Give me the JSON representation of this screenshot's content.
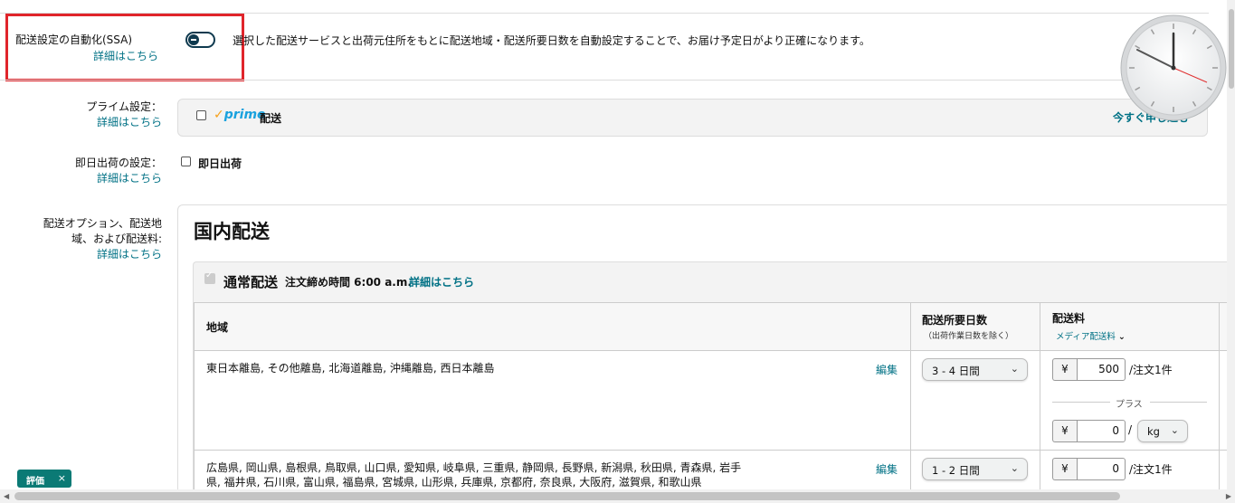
{
  "ssa": {
    "label": "配送設定の自動化(SSA)",
    "link": "詳細はこちら",
    "description": "選択した配送サービスと出荷元住所をもとに配送地域・配送所要日数を自動設定することで、お届け予定日がより正確になります。"
  },
  "prime": {
    "label": "プライム設定：",
    "link": "詳細はこちら",
    "logo_text": "prime",
    "option_label": "配送",
    "apply_link": "今すぐ申し込む"
  },
  "same_day": {
    "label": "即日出荷の設定：",
    "link": "詳細はこちら",
    "option_label": "即日出荷"
  },
  "shipping_options": {
    "label_line1": "配送オプション、配送地",
    "label_line2": "域、および配送料:",
    "link": "詳細はこちら"
  },
  "domestic": {
    "title": "国内配送",
    "standard": {
      "title": "通常配送",
      "cutoff": "注文締め時間 6:00 a.m.",
      "link": "詳細はこちら"
    },
    "table": {
      "col_region": "地域",
      "col_days": "配送所要日数",
      "col_days_sub": "（出荷作業日数を除く）",
      "col_fee": "配送料",
      "col_fee_sub": "メディア配送料",
      "rows": [
        {
          "region": "東日本離島, その他離島, 北海道離島, 沖縄離島, 西日本離島",
          "edit": "編集",
          "days": "3 - 4 日間",
          "currency": "¥",
          "fee": "500",
          "per": "/注文1件",
          "plus": "プラス",
          "weight_fee": "0",
          "weight_unit": "kg"
        },
        {
          "region_line1": "広島県, 岡山県, 島根県, 鳥取県, 山口県, 愛知県, 岐阜県, 三重県, 静岡県, 長野県, 新潟県, 秋田県, 青森県, 岩手",
          "region_line2": "県, 福井県, 石川県, 富山県, 福島県, 宮城県, 山形県, 兵庫県, 京都府, 奈良県, 大阪府, 滋賀県, 和歌山県",
          "edit": "編集",
          "days": "1 - 2 日間",
          "currency": "¥",
          "fee": "0",
          "per": "/注文1件"
        }
      ]
    }
  },
  "badge": {
    "label": "評価",
    "close": "×"
  },
  "colors": {
    "link": "#007185",
    "highlight_border": "#e0252b",
    "toggle": "#0f3a4f",
    "badge_bg": "#0b7a75",
    "prime_blue": "#1aa2de",
    "prime_orange": "#f6a01a"
  }
}
